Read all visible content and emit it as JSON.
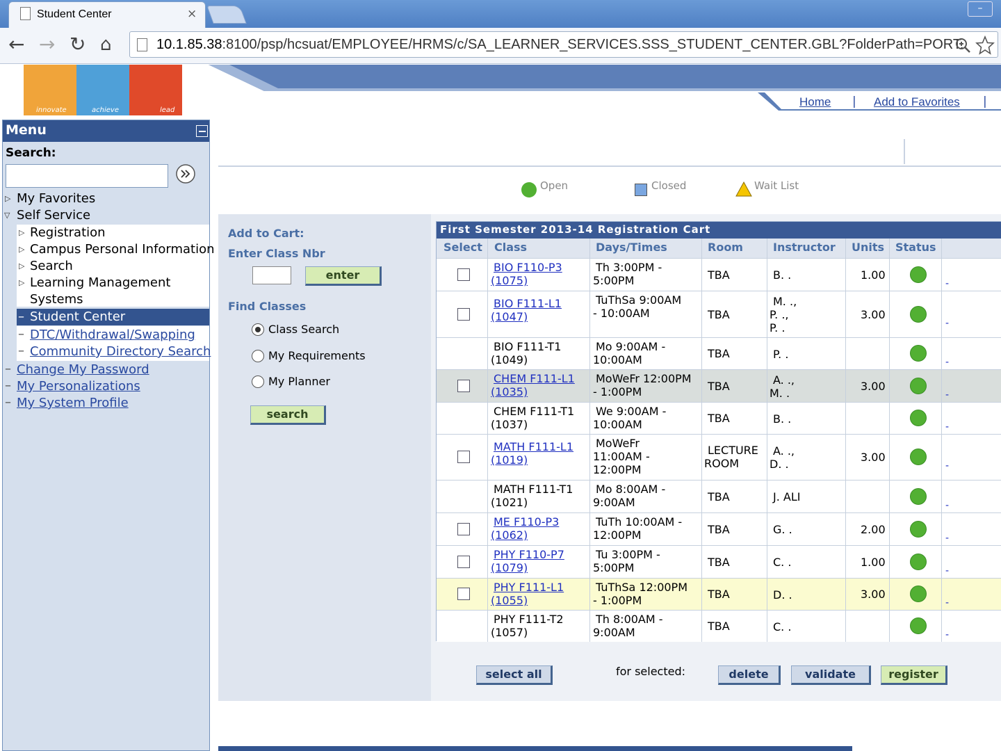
{
  "browser": {
    "tab_title": "Student Center",
    "tab_close": "×",
    "url_host": "10.1.85.38",
    "url_rest": ":8100/psp/hcsuat/EMPLOYEE/HRMS/c/SA_LEARNER_SERVICES.SSS_STUDENT_CENTER.GBL?FolderPath=PORT."
  },
  "logo": {
    "words": [
      "innovate",
      "achieve",
      "lead"
    ]
  },
  "header_links": {
    "home": "Home",
    "favorites": "Add to Favorites"
  },
  "menu": {
    "title": "Menu",
    "search_label": "Search:",
    "items": {
      "favorites": "My Favorites",
      "self_service": "Self Service",
      "registration": "Registration",
      "campus_info": "Campus Personal Information",
      "search": "Search",
      "learning_mgmt_1": "Learning Management",
      "learning_mgmt_2": "Systems",
      "student_center": "Student Center",
      "dtc": "DTC/Withdrawal/Swapping",
      "community": "Community Directory Search",
      "change_pw": "Change My Password",
      "personalizations": "My Personalizations",
      "system_profile": "My System Profile"
    }
  },
  "legend": {
    "open": "Open",
    "closed": "Closed",
    "waitlist": "Wait List"
  },
  "add_to_cart": {
    "title": "Add to Cart:",
    "enter_label": "Enter Class Nbr",
    "enter_btn": "enter",
    "find_label": "Find Classes",
    "opt_class_search": "Class Search",
    "opt_requirements": "My Requirements",
    "opt_planner": "My Planner",
    "search_btn": "search"
  },
  "cart": {
    "title": "First Semester 2013-14 Registration Cart",
    "headers": {
      "select": "Select",
      "class": "Class",
      "days": "Days/Times",
      "room": "Room",
      "instructor": "Instructor",
      "units": "Units",
      "status": "Status"
    },
    "rows": [
      {
        "class1": "BIO F110-P3",
        "class2": "(1075)",
        "days1": "Th 3:00PM -",
        "days2": "5:00PM",
        "days3": "",
        "room1": "TBA",
        "room2": "",
        "inst1": "B. .",
        "inst2": "",
        "inst3": "",
        "units": "1.00"
      },
      {
        "class1": "BIO F111-L1",
        "class2": "(1047)",
        "days1": "TuThSa 9:00AM",
        "days2": "- 10:00AM",
        "days3": "",
        "room1": "TBA",
        "room2": "",
        "inst1": "M. .,",
        "inst2": "P. .,",
        "inst3": "P. .",
        "units": "3.00"
      },
      {
        "class1": "BIO F111-T1",
        "class2": "(1049)",
        "days1": "Mo 9:00AM -",
        "days2": "10:00AM",
        "days3": "",
        "room1": "TBA",
        "room2": "",
        "inst1": "P. .",
        "inst2": "",
        "inst3": "",
        "units": ""
      },
      {
        "class1": "CHEM F111-L1",
        "class2": "(1035)",
        "days1": "MoWeFr 12:00PM",
        "days2": "- 1:00PM",
        "days3": "",
        "room1": "TBA",
        "room2": "",
        "inst1": "A. .,",
        "inst2": "M. .",
        "inst3": "",
        "units": "3.00"
      },
      {
        "class1": "CHEM F111-T1",
        "class2": "(1037)",
        "days1": "We 9:00AM -",
        "days2": "10:00AM",
        "days3": "",
        "room1": "TBA",
        "room2": "",
        "inst1": "B. .",
        "inst2": "",
        "inst3": "",
        "units": ""
      },
      {
        "class1": "MATH F111-L1",
        "class2": "(1019)",
        "days1": "MoWeFr",
        "days2": "11:00AM -",
        "days3": "12:00PM",
        "room1": "LECTURE",
        "room2": "ROOM",
        "inst1": "A. .,",
        "inst2": "D. .",
        "inst3": "",
        "units": "3.00"
      },
      {
        "class1": "MATH F111-T1",
        "class2": "(1021)",
        "days1": "Mo 8:00AM -",
        "days2": "9:00AM",
        "days3": "",
        "room1": "TBA",
        "room2": "",
        "inst1": "J. ALI",
        "inst2": "",
        "inst3": "",
        "units": ""
      },
      {
        "class1": "ME F110-P3",
        "class2": "(1062)",
        "days1": "TuTh 10:00AM -",
        "days2": "12:00PM",
        "days3": "",
        "room1": "TBA",
        "room2": "",
        "inst1": "G. .",
        "inst2": "",
        "inst3": "",
        "units": "2.00"
      },
      {
        "class1": "PHY F110-P7",
        "class2": "(1079)",
        "days1": "Tu 3:00PM -",
        "days2": "5:00PM",
        "days3": "",
        "room1": "TBA",
        "room2": "",
        "inst1": "C. .",
        "inst2": "",
        "inst3": "",
        "units": "1.00"
      },
      {
        "class1": "PHY F111-L1",
        "class2": "(1055)",
        "days1": "TuThSa 12:00PM",
        "days2": "- 1:00PM",
        "days3": "",
        "room1": "TBA",
        "room2": "",
        "inst1": "D. .",
        "inst2": "",
        "inst3": "",
        "units": "3.00"
      },
      {
        "class1": "PHY F111-T2",
        "class2": "(1057)",
        "days1": "Th 8:00AM -",
        "days2": "9:00AM",
        "days3": "",
        "room1": "TBA",
        "room2": "",
        "inst1": "C. .",
        "inst2": "",
        "inst3": "",
        "units": ""
      }
    ],
    "dash": "-",
    "for_selected": "for selected:",
    "btn_select_all": "select all",
    "btn_delete": "delete",
    "btn_validate": "validate",
    "btn_register": "register"
  },
  "colors": {
    "menu_header": "#33548f",
    "open_green": "#52b033",
    "row_highlight_gray": "#d9dedc",
    "row_highlight_yellow": "#fbfbd0"
  }
}
